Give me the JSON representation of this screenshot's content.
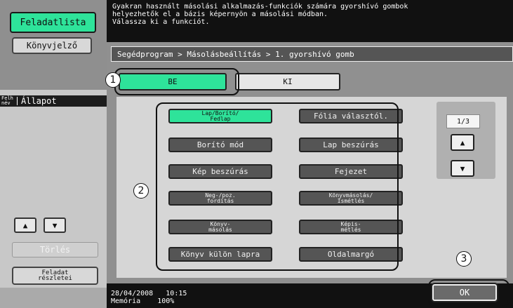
{
  "sidebar": {
    "job_list": "Feladatlista",
    "bookmark": "Könyvjelző",
    "status_col1_line1": "Felh",
    "status_col1_line2": "név",
    "status_col2": "Állapot",
    "up_arrow": "▲",
    "down_arrow": "▼",
    "delete": "Törlés",
    "job_detail_line1": "Feladat",
    "job_detail_line2": "részletei"
  },
  "message": {
    "line1": "Gyakran használt másolási alkalmazás-funkciók számára gyorshívó gombok",
    "line2": "helyezhetők el a bázis képernyön a másolási módban.",
    "line3": "Válassza ki a funkciót."
  },
  "breadcrumb": "Segédprogram > Másolásbeállítás > 1. gyorshívó gomb",
  "toggle": {
    "on": "BE",
    "off": "KI"
  },
  "functions": {
    "left": [
      "Lap/Borító/ Fedlap",
      "Borító mód",
      "Kép beszúrás",
      "Neg-/poz. fordítás",
      "Könyv- másolás",
      "Könyv külön lapra"
    ],
    "right": [
      "Fólia választól.",
      "Lap beszúrás",
      "Fejezet",
      "Könyvmásolás/ Ismétlés",
      "Képis- métlés",
      "Oldalmargó"
    ]
  },
  "pager": {
    "indicator": "1/3",
    "up": "▲",
    "down": "▼"
  },
  "footer": {
    "date": "28/04/2008",
    "time": "10:15",
    "memory_label": "Memória",
    "memory_value": "100%"
  },
  "ok_button": "OK",
  "callouts": [
    "1",
    "2",
    "3"
  ]
}
